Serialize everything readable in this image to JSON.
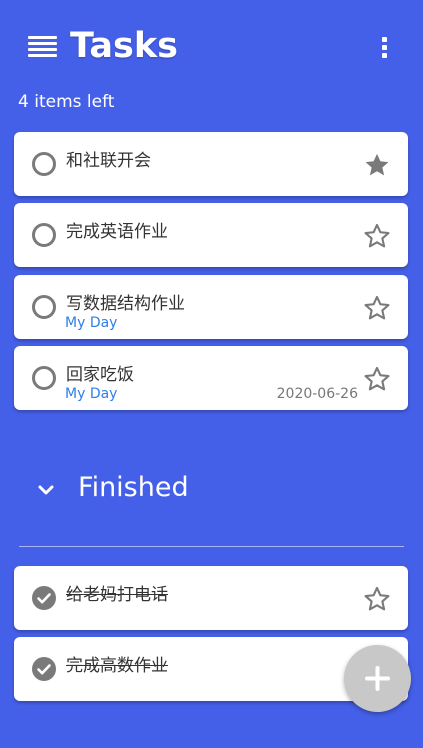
{
  "header": {
    "title": "Tasks",
    "menu_icon": "hamburger-menu-icon",
    "more_icon": "more-vertical-icon"
  },
  "summary": {
    "items_left": "4 items left"
  },
  "tasks": [
    {
      "text": "和社联开会",
      "sub": "",
      "date": "",
      "starred": true,
      "done": false
    },
    {
      "text": "完成英语作业",
      "sub": "",
      "date": "",
      "starred": false,
      "done": false
    },
    {
      "text": "写数据结构作业",
      "sub": "My Day",
      "date": "",
      "starred": false,
      "done": false
    },
    {
      "text": "回家吃饭",
      "sub": "My Day",
      "date": "2020-06-26",
      "starred": false,
      "done": false
    }
  ],
  "finished_section": {
    "label": "Finished",
    "expanded": true
  },
  "finished_tasks": [
    {
      "text": "给老妈打电话",
      "starred": false,
      "done": true
    },
    {
      "text": "完成高数作业",
      "starred": false,
      "done": true
    }
  ],
  "fab": {
    "icon": "plus-icon"
  },
  "colors": {
    "background": "#4560E8",
    "accent_text": "#2F7FE8",
    "icon_gray": "#7A7A7A",
    "fab": "#C8C8C8"
  }
}
